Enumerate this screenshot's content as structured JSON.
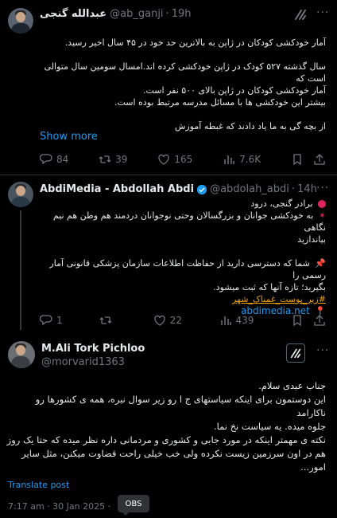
{
  "tweet1": {
    "name": "عبدالله گنجی",
    "handle": "@ab_ganji",
    "time": "19h",
    "lines": [
      "آمار خودکشی کودکان در ژاپن به بالاترین حد خود در ۴۵ سال اخیر رسید.",
      "",
      "سال گذشته ۵۲۷ کودک در ژاپن خودکشی کرده اند.امسال سومین سال متوالی است که",
      "آمار خودکشی کودکان در ژاپن بالای ۵۰۰ نفر است.",
      "بیشتر این خودکشی ها با مسائل مدرسه مرتبط بوده است.",
      "",
      "از بچه گی به ما یاد دادند که غبطه آموزش"
    ],
    "show_more": "Show more",
    "replies": "84",
    "reposts": "39",
    "likes": "165",
    "views": "7.6K"
  },
  "tweet2": {
    "name": "AbdiMedia - Abdollah Abdi",
    "handle": "@abdolah_abdi",
    "time": "14h",
    "line1": "برادر گنجی، درود",
    "line2": "به خودکشی جوانان و بزرگسالان وحتی نوجوانان دردمند هم وطن هم نیم نگاهی",
    "line3": "بیاندازید",
    "line4": "شما که دسترسی دارید از حفاظت اطلاعات سازمان پزشکی قانونی آمار رسمی را",
    "line5": "بگیرید؛ تازه آنها که ثبت میشود.",
    "hashtag": "#زیر_پوست_غمناک_شهر",
    "link": "abdimedia.net",
    "replies": "1",
    "reposts": "",
    "likes": "22",
    "views": "439"
  },
  "tweet3": {
    "name": "M.Ali Tork Pichloo",
    "handle": "@morvarid1363",
    "lines": [
      "جناب عبدی سلام.",
      "این دوستمون برای اینکه سیاستهای ج ا رو زیر سوال نبره، همه ی کشورها رو ناکارامد",
      "جلوه میده. یه سیاست نخ نما.",
      "نکته ی مهمتر اینکه در مورد جابی و کشوری و مردمانی داره نظر میده که حتا یک روز",
      "هم در اون سرزمین زیست نکرده ولی خب خیلی راحت قضاوت میکنن، مثل سایر",
      "امور..."
    ],
    "translate": "Translate post",
    "meta": "7:17 am · 30 Jan 2025 · ",
    "tooltip": "OBS"
  },
  "icons": {
    "reply": "reply-icon",
    "repost": "repost-icon",
    "like": "heart-icon",
    "views": "views-icon",
    "bookmark": "bookmark-icon",
    "share": "share-icon",
    "grok": "grok-icon",
    "more": "more-icon",
    "verified": "verified-icon",
    "red_circle": "red-circle-icon",
    "red_star": "sparkle-icon",
    "pin": "pushpin-icon",
    "location": "location-pin-icon"
  },
  "colors": {
    "background": "#000000",
    "text": "#e7e9ea",
    "secondary": "#71767b",
    "accent": "#1d9bf0",
    "divider": "#2f3336",
    "hashtag": "#f4a300"
  }
}
